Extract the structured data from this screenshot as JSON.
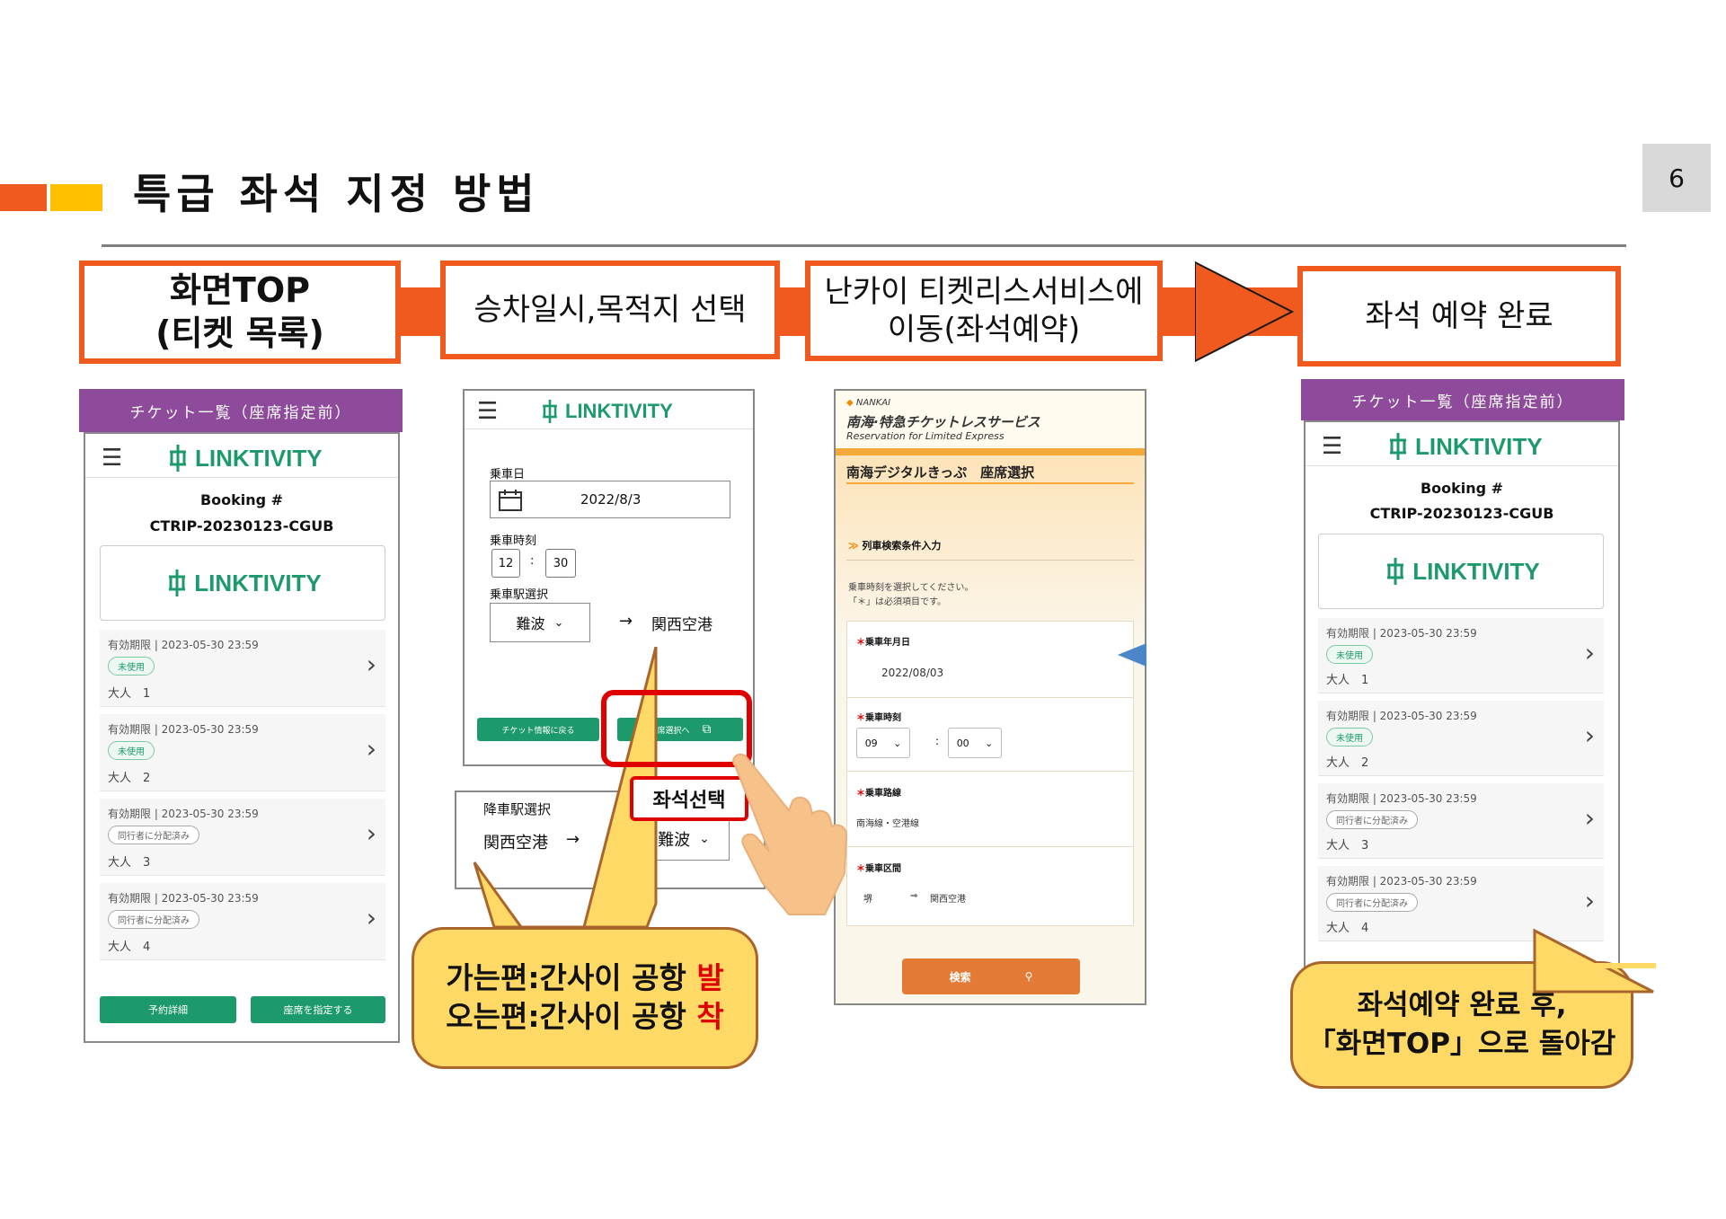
{
  "page_number": "6",
  "title": "특급 좌석 지정 방법",
  "steps": [
    {
      "line1": "화면TOP",
      "line2": "(티켓 목록)"
    },
    {
      "line1": "승차일시,목적지 선택"
    },
    {
      "line1": "난카이 티켓리스서비스에",
      "line2": "이동(좌석예약)"
    },
    {
      "line1": "좌석 예약 완료"
    }
  ],
  "ticket_list": {
    "banner": "チケット一覧（座席指定前）",
    "logo": "LINKTIVITY",
    "booking_label": "Booking #",
    "booking_no": "CTRIP-20230123-CGUB",
    "tickets": [
      {
        "expiry": "有効期限 | 2023-05-30 23:59",
        "status": "未使用",
        "adult": "大人　1"
      },
      {
        "expiry": "有効期限 | 2023-05-30 23:59",
        "status": "未使用",
        "adult": "大人　2"
      },
      {
        "expiry": "有効期限 | 2023-05-30 23:59",
        "status": "同行者に分配済み",
        "adult": "大人　3"
      },
      {
        "expiry": "有効期限 | 2023-05-30 23:59",
        "status": "同行者に分配済み",
        "adult": "大人　4"
      }
    ],
    "btn_detail": "予約詳細",
    "btn_seat": "座席を指定する"
  },
  "select_screen": {
    "logo": "LINKTIVITY",
    "date_label": "乗車日",
    "date_value": "2022/8/3",
    "time_label": "乗車時刻",
    "hour": "12",
    "minute": "30",
    "board_label": "乗車駅選択",
    "board_station": "難波",
    "arrow": "→",
    "dest_station": "関西空港",
    "btn_back": "チケット情報に戻る",
    "btn_seat_select": "座席選択へ",
    "alight_label": "降車駅選択",
    "alight_from": "関西空港",
    "alight_to": "難波",
    "seat_select_label": "좌석선택"
  },
  "nankai": {
    "brand_small": "NANKAI",
    "brand_title": "南海·特急チケットレスサービス",
    "brand_sub": "Reservation for Limited Express",
    "section_title": "南海デジタルきっぷ　座席選択",
    "search_header": "列車検索条件入力",
    "note1": "乗車時刻を選択してください。",
    "note2": "「＊」は必須項目です。",
    "date_label": "乗車年月日",
    "date_value": "2022/08/03",
    "time_label": "乗車時刻",
    "hour": "09",
    "minute": "00",
    "route_label": "乗車路線",
    "route_value": "南海線・空港線",
    "section_label": "乗車区間",
    "from": "堺",
    "to": "関西空港",
    "search_btn": "検索"
  },
  "callout_left": {
    "line1_prefix": "가는편:간사이 공항 ",
    "line1_mark": "발",
    "line2_prefix": "오는편:간사이 공항 ",
    "line2_mark": "착"
  },
  "callout_right": {
    "line1": "좌석예약 완료 후,",
    "line2": "「화면TOP」으로 돌아감"
  },
  "colors": {
    "accent": "#f05a1f",
    "yellow": "#ffc000",
    "green": "#1c9a6c",
    "purple": "#8e4b9b",
    "red": "#e00000"
  }
}
